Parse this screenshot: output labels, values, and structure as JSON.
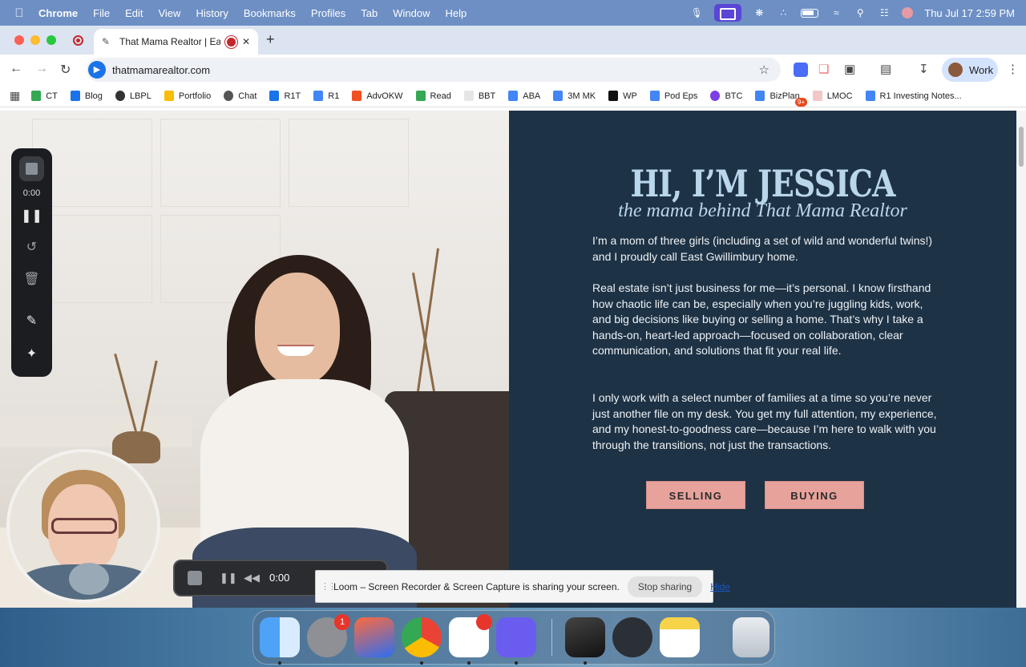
{
  "menubar": {
    "app": "Chrome",
    "items": [
      "File",
      "Edit",
      "View",
      "History",
      "Bookmarks",
      "Profiles",
      "Tab",
      "Window",
      "Help"
    ],
    "clock": "Thu Jul 17  2:59 PM"
  },
  "tab": {
    "title": "That Mama Realtor | East"
  },
  "omnibox": {
    "url": "thatmamarealtor.com"
  },
  "profile": {
    "label": "Work"
  },
  "extension_badge": "9+",
  "bookmarks": [
    {
      "label": "CT",
      "color": "#34a853"
    },
    {
      "label": "Blog",
      "color": "#1a73e8"
    },
    {
      "label": "LBPL",
      "color": "#333333"
    },
    {
      "label": "Portfolio",
      "color": "#fbbc04"
    },
    {
      "label": "Chat",
      "color": "#333333"
    },
    {
      "label": "R1T",
      "color": "#1a73e8"
    },
    {
      "label": "R1",
      "color": "#4285f4"
    },
    {
      "label": "AdvOKW",
      "color": "#f25022"
    },
    {
      "label": "Read",
      "color": "#34a853"
    },
    {
      "label": "BBT",
      "color": "#e6e6e6"
    },
    {
      "label": "ABA",
      "color": "#4285f4"
    },
    {
      "label": "3M MK",
      "color": "#4285f4"
    },
    {
      "label": "WP",
      "color": "#111111"
    },
    {
      "label": "Pod Eps",
      "color": "#4285f4"
    },
    {
      "label": "BTC",
      "color": "#7b3fe4"
    },
    {
      "label": "BizPlan",
      "color": "#4285f4"
    },
    {
      "label": "LMOC",
      "color": "#f2c7c7"
    },
    {
      "label": "R1 Investing Notes...",
      "color": "#4285f4"
    }
  ],
  "page": {
    "heading": "HI, I’M JESSICA",
    "subheading": "the mama behind That Mama Realtor",
    "paragraph1": "I’m a mom of three girls (including a set of wild and wonderful twins!) and I proudly call East Gwillimbury home.",
    "paragraph2": "Real estate isn’t just business for me—it’s personal. I know firsthand how chaotic life can be, especially when you’re juggling kids, work, and big decisions like buying or selling a home. That’s why I take a hands-on, heart-led approach—focused on collaboration, clear communication, and solutions that fit your real life.",
    "paragraph3": "I only work with a select number of families at a time so you’re never just another file on my desk. You get my full attention, my experience, and my honest-to-goodness care—because I’m here to walk with you through the transitions, not just the transactions.",
    "buttons": {
      "selling": "SELLING",
      "buying": "BUYING"
    },
    "colors": {
      "panel": "#1e3245",
      "heading": "#b9d6ea",
      "button": "#e8a29c"
    }
  },
  "loom": {
    "sidebar_time": "0:00",
    "toolbar_time": "0:00"
  },
  "share_banner": {
    "message": "Loom – Screen Recorder & Screen Capture is sharing your screen.",
    "stop_label": "Stop sharing",
    "hide_label": "Hide"
  },
  "dock": {
    "settings_badge": "1",
    "apps": [
      "finder-icon",
      "system-settings-icon",
      "iphone-mirroring-icon",
      "chrome-icon",
      "asana-icon",
      "perplexity-icon",
      "garageband-icon",
      "quicktime-icon",
      "notes-icon",
      "trash-icon"
    ]
  }
}
